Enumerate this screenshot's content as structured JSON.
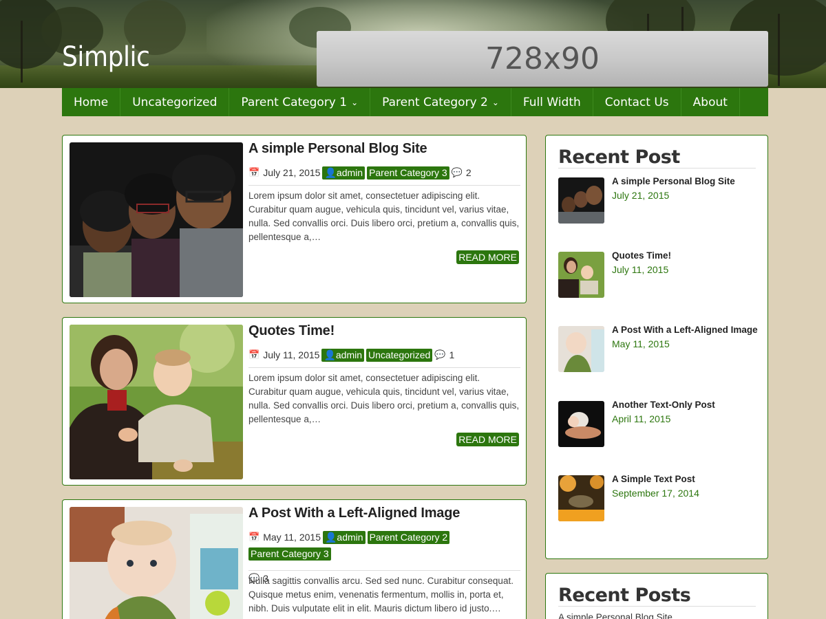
{
  "site": {
    "title": "Simplic",
    "ad_text": "728x90"
  },
  "nav": {
    "items": [
      {
        "label": "Home",
        "has_dropdown": false
      },
      {
        "label": "Uncategorized",
        "has_dropdown": false
      },
      {
        "label": "Parent Category 1",
        "has_dropdown": true
      },
      {
        "label": "Parent Category 2",
        "has_dropdown": true
      },
      {
        "label": "Full Width",
        "has_dropdown": false
      },
      {
        "label": "Contact Us",
        "has_dropdown": false
      },
      {
        "label": "About",
        "has_dropdown": false
      }
    ]
  },
  "colors": {
    "accent": "#2c760e",
    "background": "#ddd1b8"
  },
  "posts": [
    {
      "title": "A simple Personal Blog Site",
      "date": "July 21, 2015",
      "author": "admin",
      "categories": [
        "Parent Category 3"
      ],
      "comments": "2",
      "excerpt": "Lorem ipsum dolor sit amet, consectetuer adipiscing elit. Curabitur quam augue, vehicula quis, tincidunt vel, varius vitae, nulla. Sed convallis orci. Duis libero orci, pretium a, convallis quis, pellentesque a,…",
      "read_more": "READ MORE"
    },
    {
      "title": "Quotes Time!",
      "date": "July 11, 2015",
      "author": "admin",
      "categories": [
        "Uncategorized"
      ],
      "comments": "1",
      "excerpt": "Lorem ipsum dolor sit amet, consectetuer adipiscing elit. Curabitur quam augue, vehicula quis, tincidunt vel, varius vitae, nulla. Sed convallis orci. Duis libero orci, pretium a, convallis quis, pellentesque a,…",
      "read_more": "READ MORE"
    },
    {
      "title": "A Post With a Left-Aligned Image",
      "date": "May 11, 2015",
      "author": "admin",
      "categories": [
        "Parent Category 2",
        "Parent Category 3"
      ],
      "comments": "3",
      "excerpt": " Nulla sagittis convallis arcu. Sed sed nunc. Curabitur consequat. Quisque metus enim, venenatis fermentum, mollis in, porta et, nibh. Duis vulputate elit in elit. Mauris dictum libero id justo.…"
    }
  ],
  "sidebar": {
    "recent_post": {
      "title": "Recent Post",
      "items": [
        {
          "title": "A simple Personal Blog Site",
          "date": "July 21, 2015"
        },
        {
          "title": "Quotes Time!",
          "date": "July 11, 2015"
        },
        {
          "title": "A Post With a Left-Aligned Image",
          "date": "May 11, 2015"
        },
        {
          "title": "Another Text-Only Post",
          "date": "April 11, 2015"
        },
        {
          "title": "A Simple Text Post",
          "date": "September 17, 2014"
        }
      ]
    },
    "recent_posts": {
      "title": "Recent Posts",
      "first_item": "A simple Personal Blog Site"
    }
  }
}
